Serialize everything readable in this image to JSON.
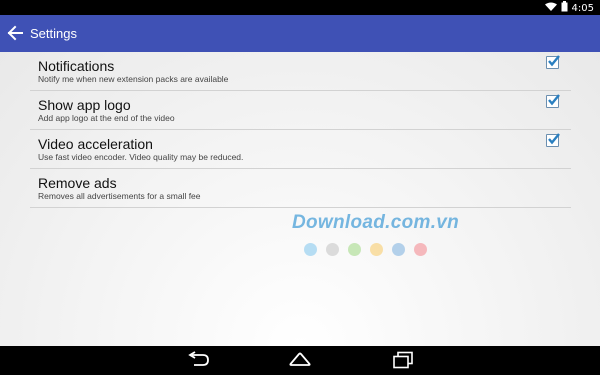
{
  "status_bar": {
    "time": "4:05",
    "icons": [
      "wifi-icon",
      "battery-icon"
    ]
  },
  "app_bar": {
    "title": "Settings",
    "back_icon": "arrow-left-icon",
    "color": "#3f51b5"
  },
  "settings": [
    {
      "title": "Notifications",
      "summary": "Notify me when new extension packs are available",
      "checked": true
    },
    {
      "title": "Show app logo",
      "summary": "Add app logo at the end of the video",
      "checked": true
    },
    {
      "title": "Video acceleration",
      "summary": "Use fast video encoder. Video quality may be reduced.",
      "checked": true
    },
    {
      "title": "Remove ads",
      "summary": "Removes all advertisements for a small fee",
      "checked": null
    }
  ],
  "watermark": {
    "text": "Download.com.vn",
    "dot_colors": [
      "#9fd3f0",
      "#d0d0d0",
      "#b5e0a0",
      "#f8d58a",
      "#9cc3e6",
      "#f4a3a8"
    ]
  },
  "nav_bar": {
    "buttons": [
      "back-nav-icon",
      "home-nav-icon",
      "recents-nav-icon"
    ]
  }
}
